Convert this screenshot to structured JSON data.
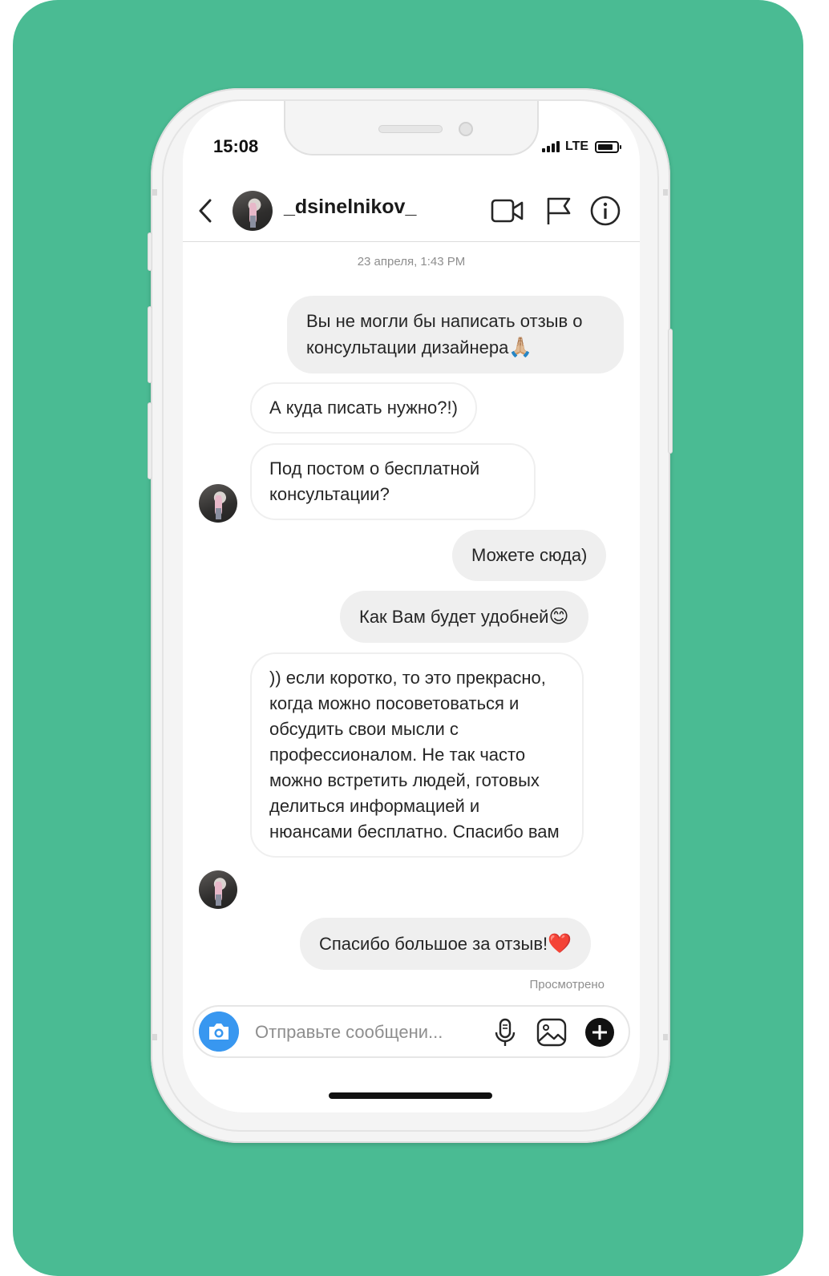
{
  "status_bar": {
    "time": "15:08",
    "network": "LTE"
  },
  "header": {
    "username": "_dsinelnikov_"
  },
  "chat": {
    "timestamp": "23 апреля, 1:43 PM",
    "messages": [
      {
        "from": "me",
        "text": "Вы не могли бы написать отзыв о консультации дизайнера",
        "emoji": "🙏🏼"
      },
      {
        "from": "them",
        "text": "А куда писать нужно?!)",
        "emoji": ""
      },
      {
        "from": "them",
        "text": "Под постом о бесплатной консультации?",
        "emoji": ""
      },
      {
        "from": "me",
        "text": "Можете сюда)",
        "emoji": ""
      },
      {
        "from": "me",
        "text": "Как Вам будет удобней",
        "emoji": "😊"
      },
      {
        "from": "them",
        "text": ")) если коротко, то это прекрасно, когда можно посоветоваться и обсудить свои мысли с профессионалом. Не так часто можно встретить людей, готовых делиться информацией и нюансами бесплатно. Спасибо вам",
        "emoji": ""
      },
      {
        "from": "me",
        "text": "Спасибо большое за отзыв!",
        "emoji": "❤️"
      }
    ],
    "seen_label": "Просмотрено"
  },
  "composer": {
    "placeholder": "Отправьте сообщени..."
  },
  "colors": {
    "background": "#4abb93",
    "accent": "#3897f0",
    "bubble_me": "#efefef"
  },
  "icons": [
    "back-icon",
    "video-call-icon",
    "flag-icon",
    "info-icon",
    "camera-icon",
    "microphone-icon",
    "gallery-icon",
    "plus-icon"
  ]
}
